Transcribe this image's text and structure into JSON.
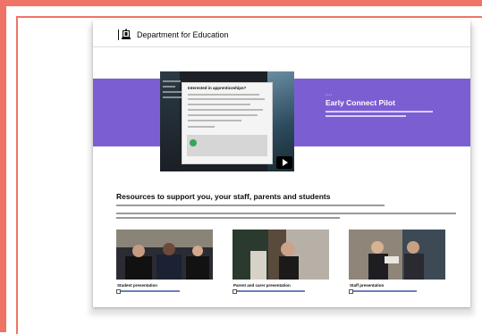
{
  "header": {
    "department": "Department for Education"
  },
  "hero": {
    "title": "Early Connect Pilot",
    "video_popup_title": "Interested in apprenticeships?"
  },
  "resources": {
    "heading": "Resources to support you, your staff, parents and students",
    "cards": [
      {
        "title": "Student presentation"
      },
      {
        "title": "Parent and carer presentation"
      },
      {
        "title": "Staff presentation"
      }
    ]
  },
  "colors": {
    "accent_frame": "#ef7466",
    "hero_band": "#7b5fd2",
    "text": "#0b0c0c"
  }
}
